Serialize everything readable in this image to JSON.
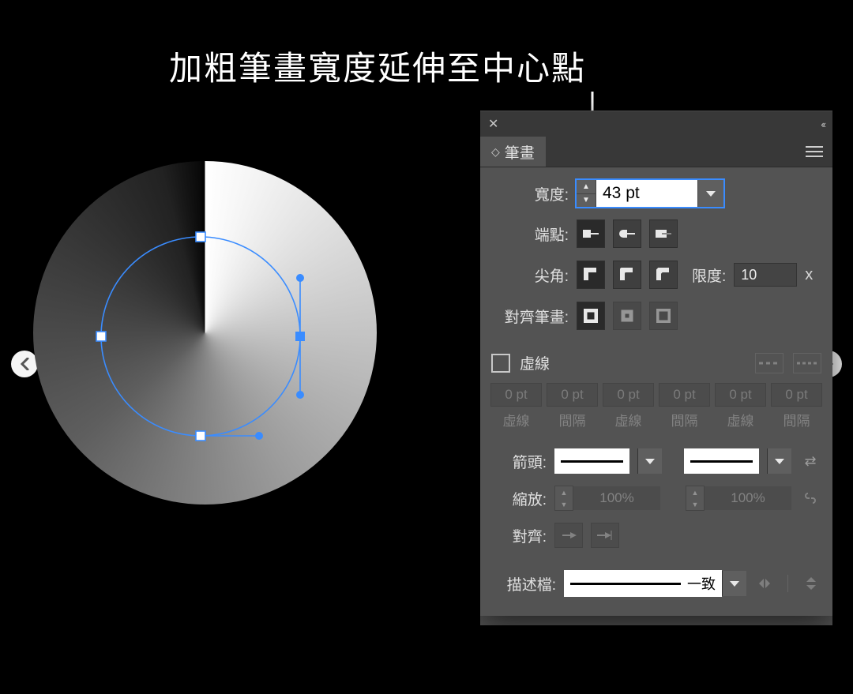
{
  "caption": "加粗筆畫寬度延伸至中心點",
  "panel": {
    "tab": "筆畫",
    "width_label": "寬度:",
    "width_value": "43 pt",
    "cap_label": "端點:",
    "corner_label": "尖角:",
    "limit_label": "限度:",
    "limit_value": "10",
    "limit_unit": "x",
    "align_label": "對齊筆畫:",
    "dashed_label": "虛線",
    "dash_value": "0 pt",
    "dash_labels": [
      "虛線",
      "間隔",
      "虛線",
      "間隔",
      "虛線",
      "間隔"
    ],
    "arrow_label": "箭頭:",
    "scale_label": "縮放:",
    "scale_value": "100%",
    "arrow_align_label": "對齊:",
    "profile_label": "描述檔:",
    "profile_value": "一致"
  }
}
